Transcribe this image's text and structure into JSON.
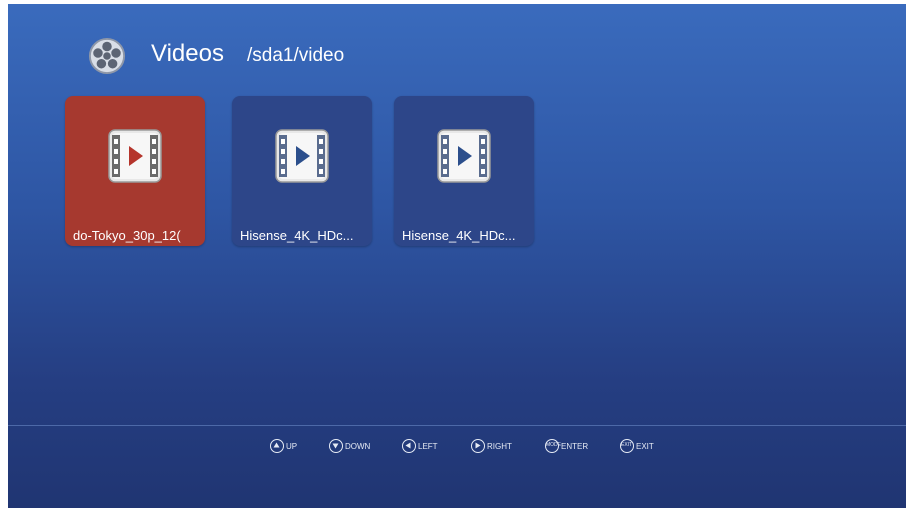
{
  "header": {
    "title": "Videos",
    "path": "/sda1/video",
    "icon": "film-reel-icon"
  },
  "files": [
    {
      "name": "do-Tokyo_30p_12(",
      "selected": true,
      "icon": "video-file-icon"
    },
    {
      "name": "Hisense_4K_HDc...",
      "selected": false,
      "icon": "video-file-icon"
    },
    {
      "name": "Hisense_4K_HDc...",
      "selected": false,
      "icon": "video-file-icon"
    }
  ],
  "footer": {
    "hints": [
      {
        "label": "UP",
        "icon": "up-arrow-icon"
      },
      {
        "label": "DOWN",
        "icon": "down-arrow-icon"
      },
      {
        "label": "LEFT",
        "icon": "left-arrow-icon"
      },
      {
        "label": "RIGHT",
        "icon": "right-arrow-icon"
      },
      {
        "label": "ENTER",
        "icon": "enter-key-icon",
        "key": "MODE"
      },
      {
        "label": "EXIT",
        "icon": "exit-key-icon",
        "key": "EXIT"
      }
    ]
  },
  "colors": {
    "selected_tile": "#a6392f",
    "tile": "#2d4689",
    "background_top": "#3a6bbd",
    "background_bottom": "#203572"
  }
}
